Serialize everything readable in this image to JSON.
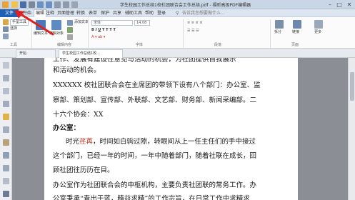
{
  "window": {
    "title": "学生校园工作总结1校社团联合会工作总结.pdf - 福昕高级PDF编辑器",
    "minimize_icon": "minimize-icon",
    "maximize_icon": "maximize-icon",
    "close_icon": "close-icon"
  },
  "menu": {
    "file": "文件",
    "items": [
      "开始",
      "编辑",
      "注释",
      "页面管理",
      "转换",
      "表单",
      "保护",
      "共享",
      "辅助工具",
      "帮助",
      "登录"
    ],
    "active_index": 1,
    "search_placeholder": "告诉我您想要做什么..."
  },
  "ribbon": {
    "hand_tool": "手型工具",
    "select_tool": "选择",
    "group_tools": "工具",
    "edit_text": "编辑文本",
    "edit_object": "编辑对象",
    "add_text": "添加文本",
    "group_edit": "编辑内容",
    "font_name": "宋体",
    "font_size": "14.08",
    "group_font": "字体",
    "group_paragraph": "段落",
    "split": "拆分",
    "link": "链接",
    "group_page": "页面",
    "more": "更多"
  },
  "tabs": {
    "start": "开始",
    "doc": "学生校园工作总结1校..."
  },
  "document": {
    "line1_a": "和活动的机会。",
    "line2": "XXXXXX 校社团联合会在主席团的带领下设有八个部门：办公室、监",
    "line3": "察部、策划部、宣传部、外联部、文艺部、财务部、新闻采编部。二",
    "line4": "十六个协会：XX",
    "heading": "办公室：",
    "line5_a": "时光",
    "line5_hl": "荏苒",
    "line5_b": "，时间如白驹过隙，转眼间从上一任主任们的手中接过",
    "line6": "这个部门，已经一年的时间，一年中随着部门，随着社联在成长，回",
    "line7": "顾社团往历历在目。",
    "line8": "办公室作为社团联合会的中枢机构，主要负责社团联的常务工作。办",
    "line9": "公室秉承“青出于蓝，精益求精”的工作宗旨，在日常工作中求精求",
    "line0": "工作、发展有建设性意见与活动的机会，为社团提供自我展示"
  },
  "colors": {
    "file_tab": "#1f5fb4",
    "arrow": "#e02020",
    "page_bg": "#8b8f95"
  }
}
